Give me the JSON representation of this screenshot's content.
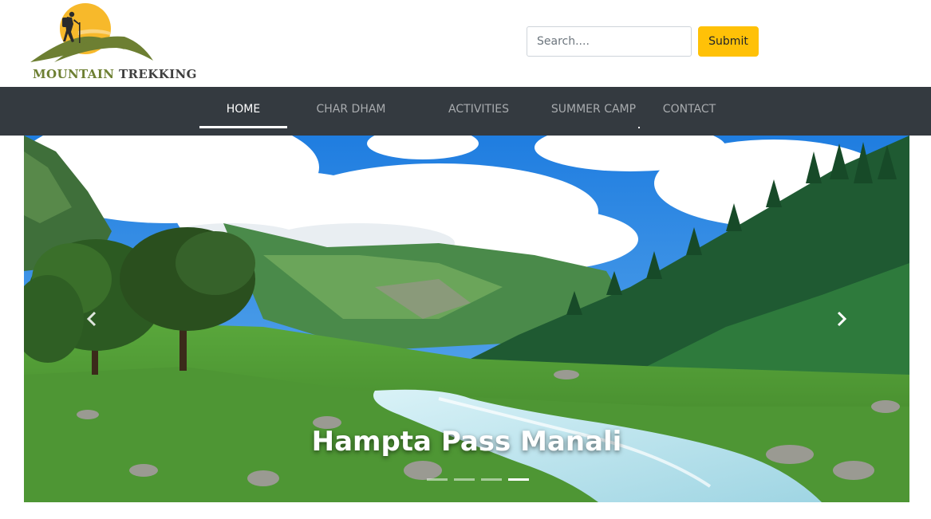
{
  "brand": {
    "logo_text_word1": "MOUNTAIN",
    "logo_text_word2": "TREKKING",
    "colors": {
      "sun": "#f7b92b",
      "hills": "#6d7f32",
      "text_dark": "#3e3e3e"
    }
  },
  "search": {
    "placeholder": "Search....",
    "value": "",
    "submit_label": "Submit",
    "submit_color": "#ffc107"
  },
  "nav": {
    "background": "#343a40",
    "items": [
      {
        "label": "HOME",
        "active": true
      },
      {
        "label": "CHAR DHAM",
        "active": false
      },
      {
        "label": "ACTIVITIES",
        "active": false
      },
      {
        "label": "SUMMER CAMP",
        "active": false
      },
      {
        "label": "CONTACT",
        "active": false
      }
    ]
  },
  "carousel": {
    "caption": "Hampta Pass Manali",
    "prev_icon": "chevron-left-icon",
    "next_icon": "chevron-right-icon",
    "indicator_count": 4,
    "active_indicator": 3
  }
}
